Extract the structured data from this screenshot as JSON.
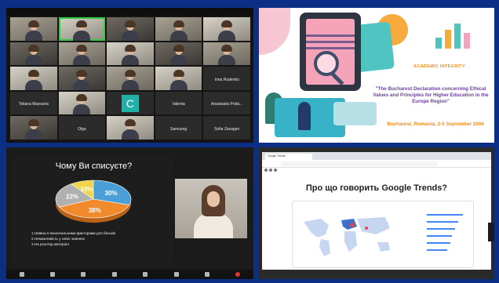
{
  "gallery": {
    "tiles": [
      {
        "name": "",
        "kind": "video"
      },
      {
        "name": "",
        "kind": "video",
        "active": true
      },
      {
        "name": "",
        "kind": "video"
      },
      {
        "name": "",
        "kind": "video"
      },
      {
        "name": "",
        "kind": "video"
      },
      {
        "name": "",
        "kind": "video"
      },
      {
        "name": "",
        "kind": "video"
      },
      {
        "name": "",
        "kind": "video"
      },
      {
        "name": "",
        "kind": "video"
      },
      {
        "name": "",
        "kind": "video"
      },
      {
        "name": "",
        "kind": "video"
      },
      {
        "name": "",
        "kind": "video"
      },
      {
        "name": "",
        "kind": "video"
      },
      {
        "name": "",
        "kind": "video"
      },
      {
        "name": "Irina Rudenko",
        "kind": "text"
      },
      {
        "name": "Tetiana Maevaria",
        "kind": "text"
      },
      {
        "name": "",
        "kind": "video"
      },
      {
        "name": "",
        "kind": "avatar",
        "letter": "C"
      },
      {
        "name": "Valeriia",
        "kind": "text"
      },
      {
        "name": "Anastasiia Poda...",
        "kind": "text"
      },
      {
        "name": "",
        "kind": "video"
      },
      {
        "name": "Olga",
        "kind": "text"
      },
      {
        "name": "",
        "kind": "video"
      },
      {
        "name": "Samsung",
        "kind": "text"
      },
      {
        "name": "Sofia Zavagen",
        "kind": "text"
      }
    ]
  },
  "slide_right": {
    "kicker": "ACADEMIC INTEGRITY",
    "title": "\"The Bucharest Declaration concerning Ethical Values and Principles for Higher Education in the Europe Region\"",
    "place": "Bucharest, Romania, 2-5 September 2004"
  },
  "slide_left": {
    "title": "Чому Ви списуєте?",
    "items": [
      "1.Наївна я визначальними факторами для батьків",
      "2.Неможливість у своїх знаннях",
      "3.На розгляд матеріал"
    ]
  },
  "chart_data": {
    "type": "pie",
    "categories": [
      "",
      "",
      "",
      ""
    ],
    "values": [
      30,
      38,
      22,
      10
    ],
    "labels": [
      "30%",
      "38%",
      "22%",
      "10%"
    ],
    "colors": [
      "#4a9fd8",
      "#f18a2a",
      "#b0b0b0",
      "#f2d44b"
    ],
    "title": ""
  },
  "browser": {
    "tab_title": "Google Trends",
    "heading": "Про що говорить Google Trends?"
  },
  "colors": {
    "background": "#0c2f86",
    "active_border": "#2ecc40"
  }
}
